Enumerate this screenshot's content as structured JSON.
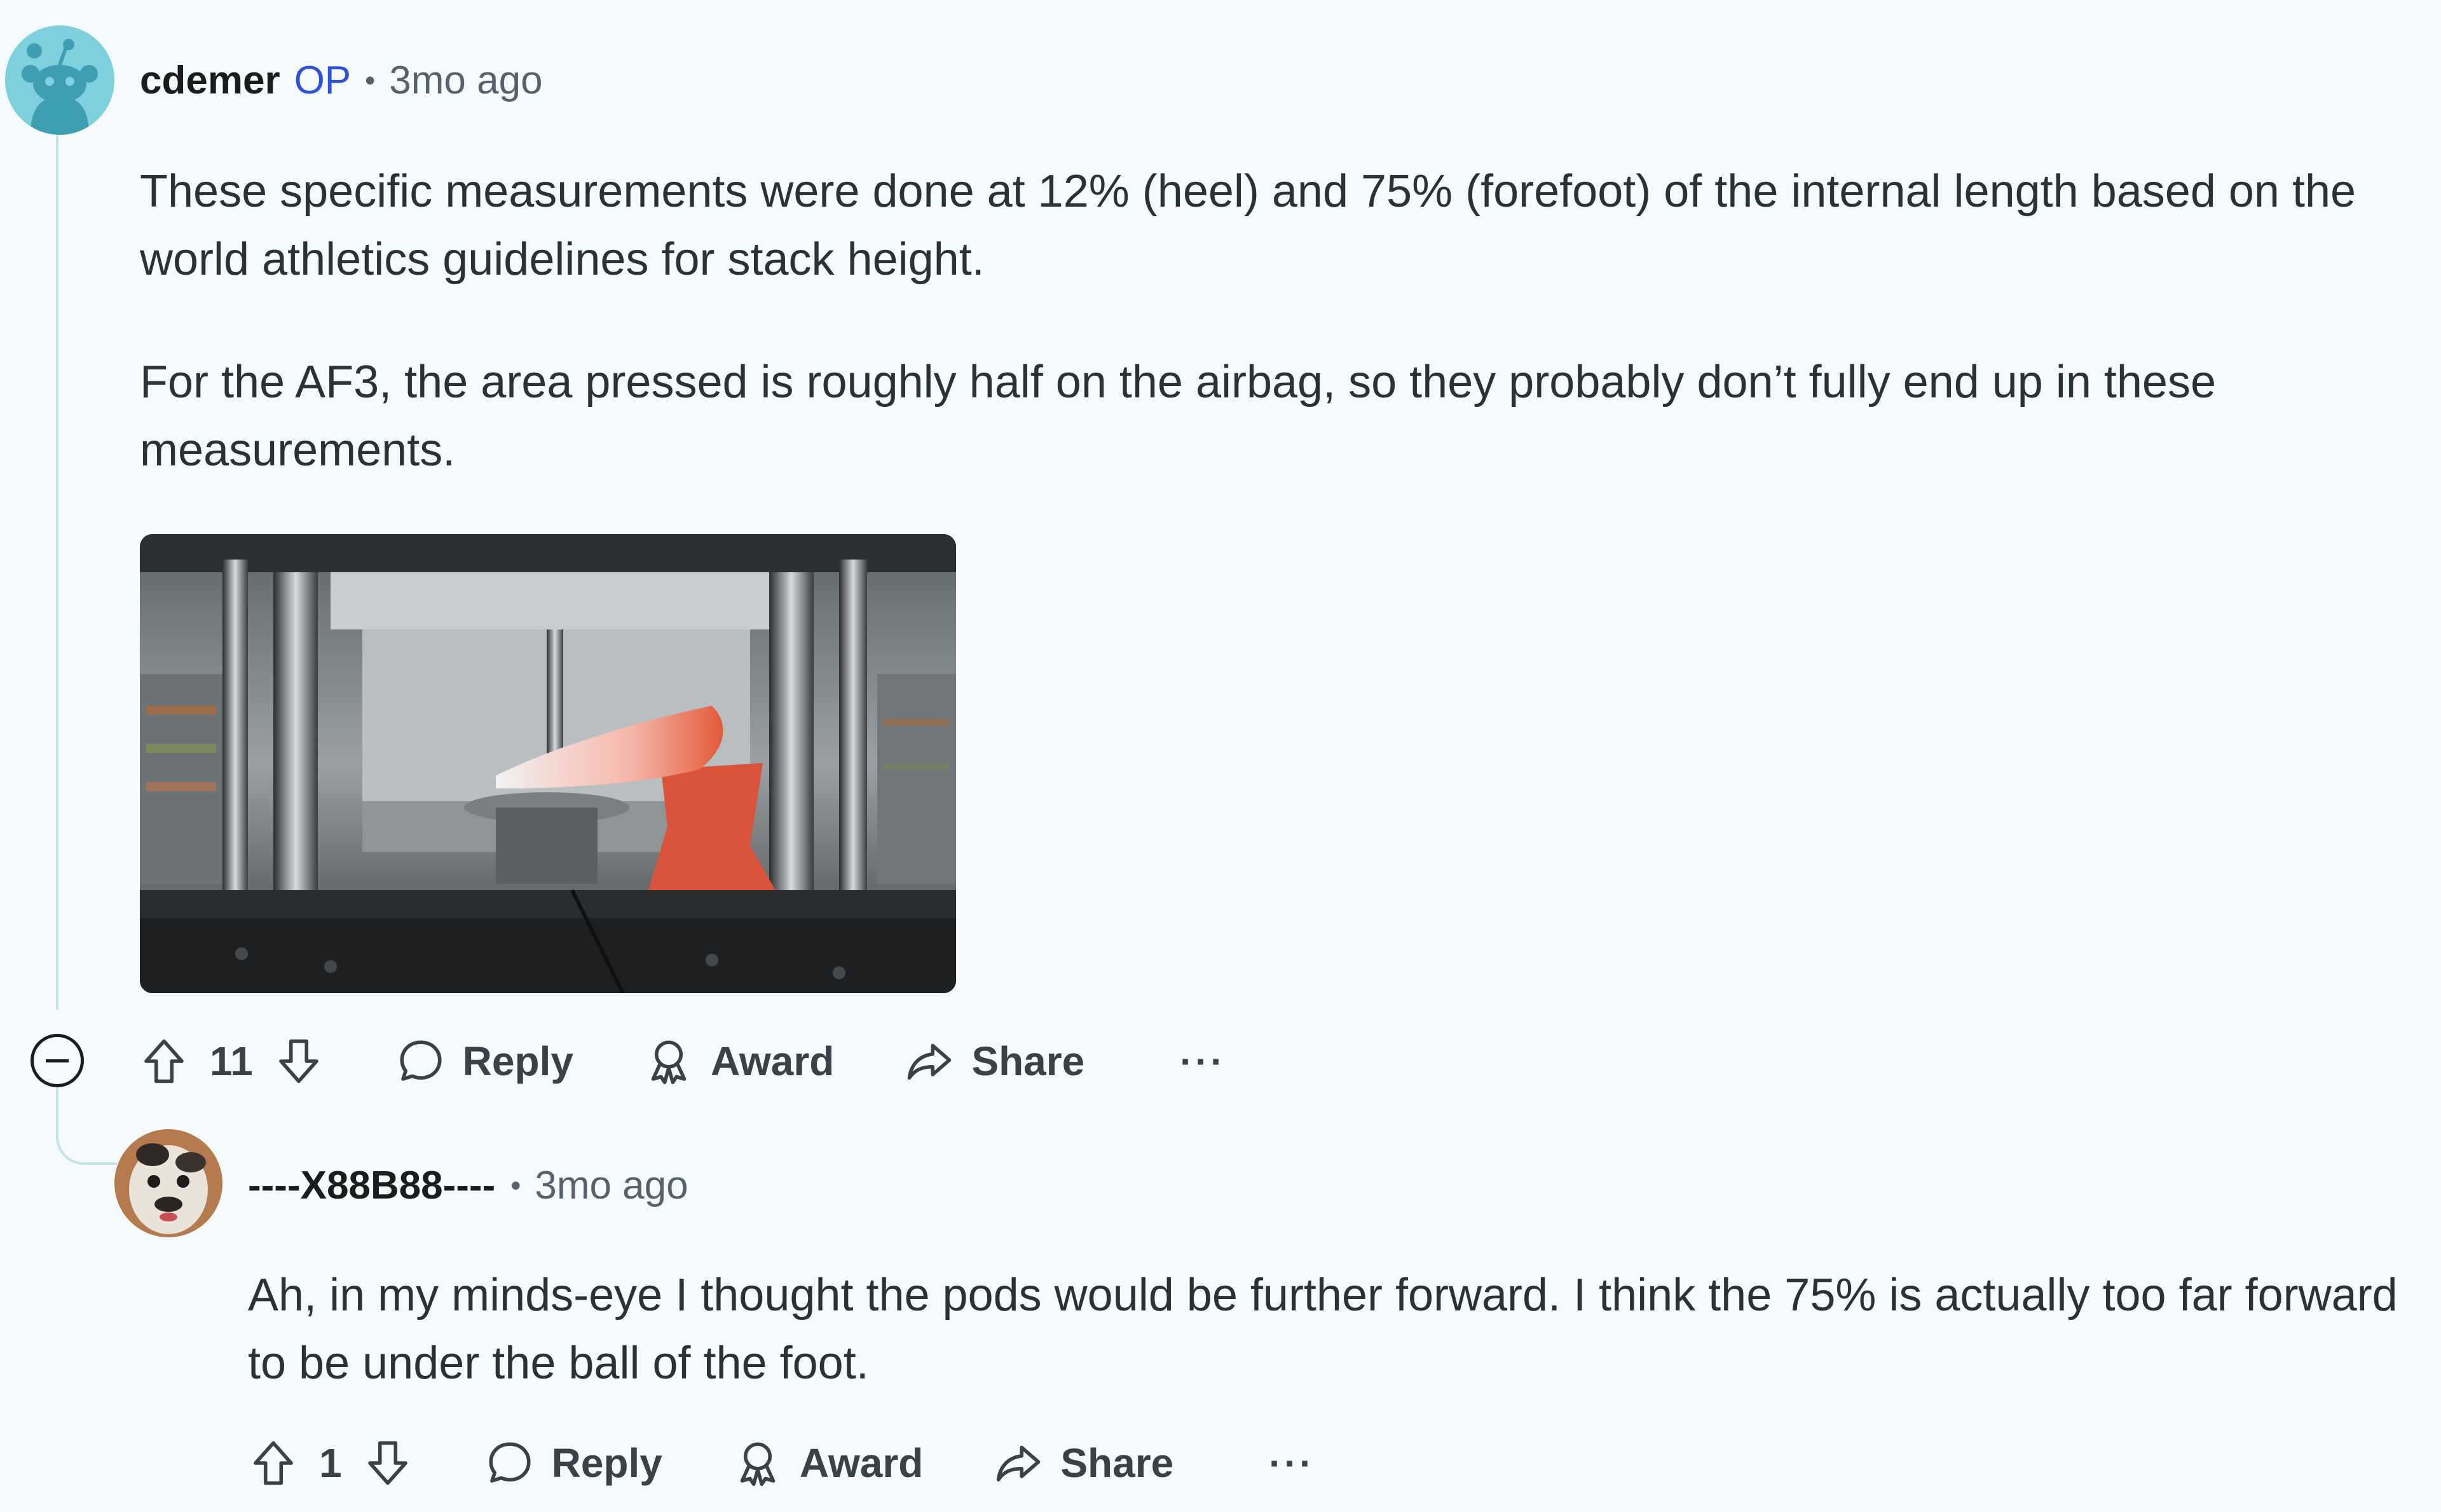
{
  "op_comment": {
    "username": "cdemer",
    "op_tag": "OP",
    "separator": "•",
    "time": "3mo ago",
    "paragraphs": [
      "These specific measurements were done at 12% (heel) and 75% (forefoot) of the internal length based on the world athletics guidelines for stack height.",
      "For the AF3, the area pressed is roughly half on the airbag, so they probably don’t fully end up in these measurements."
    ],
    "score": "11",
    "reply_label": "Reply",
    "award_label": "Award",
    "share_label": "Share",
    "more_label": "···"
  },
  "reply_comment": {
    "username": "----X88B88----",
    "separator": "•",
    "time": "3mo ago",
    "paragraphs": [
      "Ah, in my minds-eye I thought the pods would be further forward. I think the 75% is actually too far forward to be under the ball of the foot."
    ],
    "score": "1",
    "reply_label": "Reply",
    "award_label": "Award",
    "share_label": "Share",
    "more_label": "···"
  },
  "icons": {
    "upvote": "upvote-icon",
    "downvote": "downvote-icon",
    "reply": "speech-bubble-icon",
    "award": "award-ribbon-icon",
    "share": "share-arrow-icon",
    "collapse": "collapse-minus-icon"
  },
  "colors": {
    "background": "#f5fbfd",
    "op_tag": "#3050d8",
    "meta_text": "#56626b",
    "thread_line": "#c6e3ea",
    "avatar_op": "#7fd0dd"
  }
}
